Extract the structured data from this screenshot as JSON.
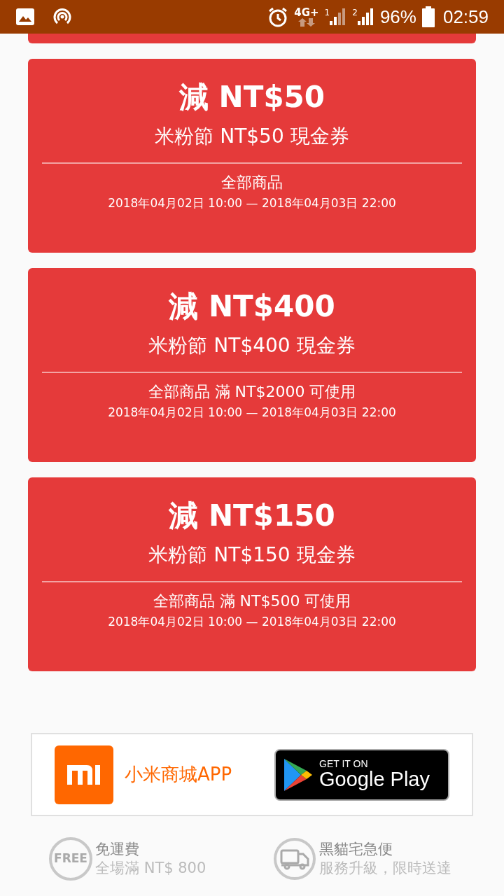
{
  "status_bar": {
    "network": "4G+",
    "sim_1": "1",
    "sim_2": "2",
    "battery": "96%",
    "time": "02:59"
  },
  "coupons": [
    {
      "amount": "減 NT$50",
      "name": "米粉節 NT$50 現金券",
      "scope": "全部商品",
      "period": "2018年04月02日 10:00 — 2018年04月03日 22:00"
    },
    {
      "amount": "減 NT$400",
      "name": "米粉節 NT$400 現金券",
      "scope": "全部商品 滿 NT$2000 可使用",
      "period": "2018年04月02日 10:00 — 2018年04月03日 22:00"
    },
    {
      "amount": "減 NT$150",
      "name": "米粉節 NT$150 現金券",
      "scope": "全部商品 滿 NT$500 可使用",
      "period": "2018年04月02日 10:00 — 2018年04月03日 22:00"
    }
  ],
  "app_banner": {
    "app_name": "小米商城APP",
    "store_badge": {
      "line_1": "GET IT ON",
      "line_2": "Google Play"
    }
  },
  "features": [
    {
      "kind": "free",
      "badge": "FREE",
      "title": "免運費",
      "subtitle": "全場滿 NT$ 800"
    },
    {
      "kind": "truck",
      "title": "黑貓宅急便",
      "subtitle": "服務升級，限時送達"
    }
  ]
}
